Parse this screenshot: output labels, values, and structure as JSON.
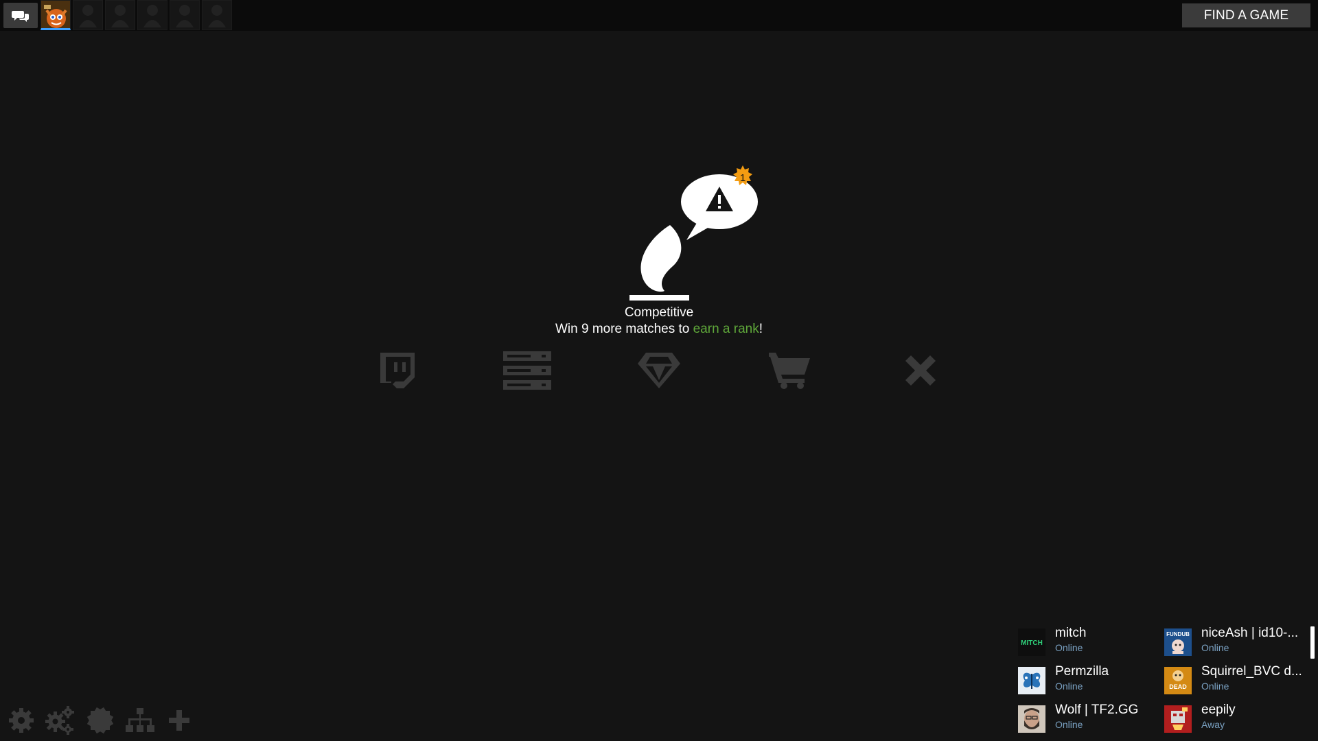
{
  "topbar": {
    "chat_icon": "chat-bubbles-icon",
    "party_slots": [
      {
        "kind": "player-avatar"
      },
      {
        "kind": "empty"
      },
      {
        "kind": "empty"
      },
      {
        "kind": "empty"
      },
      {
        "kind": "empty"
      },
      {
        "kind": "empty"
      }
    ],
    "find_game_label": "FIND A GAME"
  },
  "hero": {
    "notification_count": "1",
    "mode_title": "Competitive",
    "rank_text_prefix": "Win 9 more matches to ",
    "rank_link": "earn a rank",
    "rank_text_suffix": "!",
    "link_color": "#5fa83a",
    "badge_color": "#f39c12"
  },
  "actions": [
    {
      "icon": "twitch-icon"
    },
    {
      "icon": "server-list-icon"
    },
    {
      "icon": "diamond-icon"
    },
    {
      "icon": "cart-icon"
    },
    {
      "icon": "close-icon"
    }
  ],
  "tools": [
    {
      "icon": "settings-icon"
    },
    {
      "icon": "advanced-settings-icon"
    },
    {
      "icon": "badge-icon"
    },
    {
      "icon": "network-icon"
    },
    {
      "icon": "add-icon"
    }
  ],
  "friends": [
    {
      "name": "mitch",
      "status": "Online",
      "avatar_text": "MITCH",
      "avatar_bg": "#0e0e0e",
      "avatar_fg": "#2fd07a"
    },
    {
      "name": "niceAsh | id10-...",
      "status": "Online",
      "avatar_text": "FUNDUB",
      "avatar_bg": "#1d4f8c",
      "avatar_fg": "#ffffff"
    },
    {
      "name": "Permzilla",
      "status": "Online",
      "avatar_text": "",
      "avatar_bg": "#e8eef4",
      "avatar_fg": "#2a73b8"
    },
    {
      "name": "Squirrel_BVC d...",
      "status": "Online",
      "avatar_text": "DEAD",
      "avatar_bg": "#d48a14",
      "avatar_fg": "#ffffff"
    },
    {
      "name": "Wolf | TF2.GG",
      "status": "Online",
      "avatar_text": "",
      "avatar_bg": "#9a8a7a",
      "avatar_fg": "#2a2a2a"
    },
    {
      "name": "eepily",
      "status": "Away",
      "avatar_text": "",
      "avatar_bg": "#b21e1e",
      "avatar_fg": "#ffd060"
    }
  ]
}
